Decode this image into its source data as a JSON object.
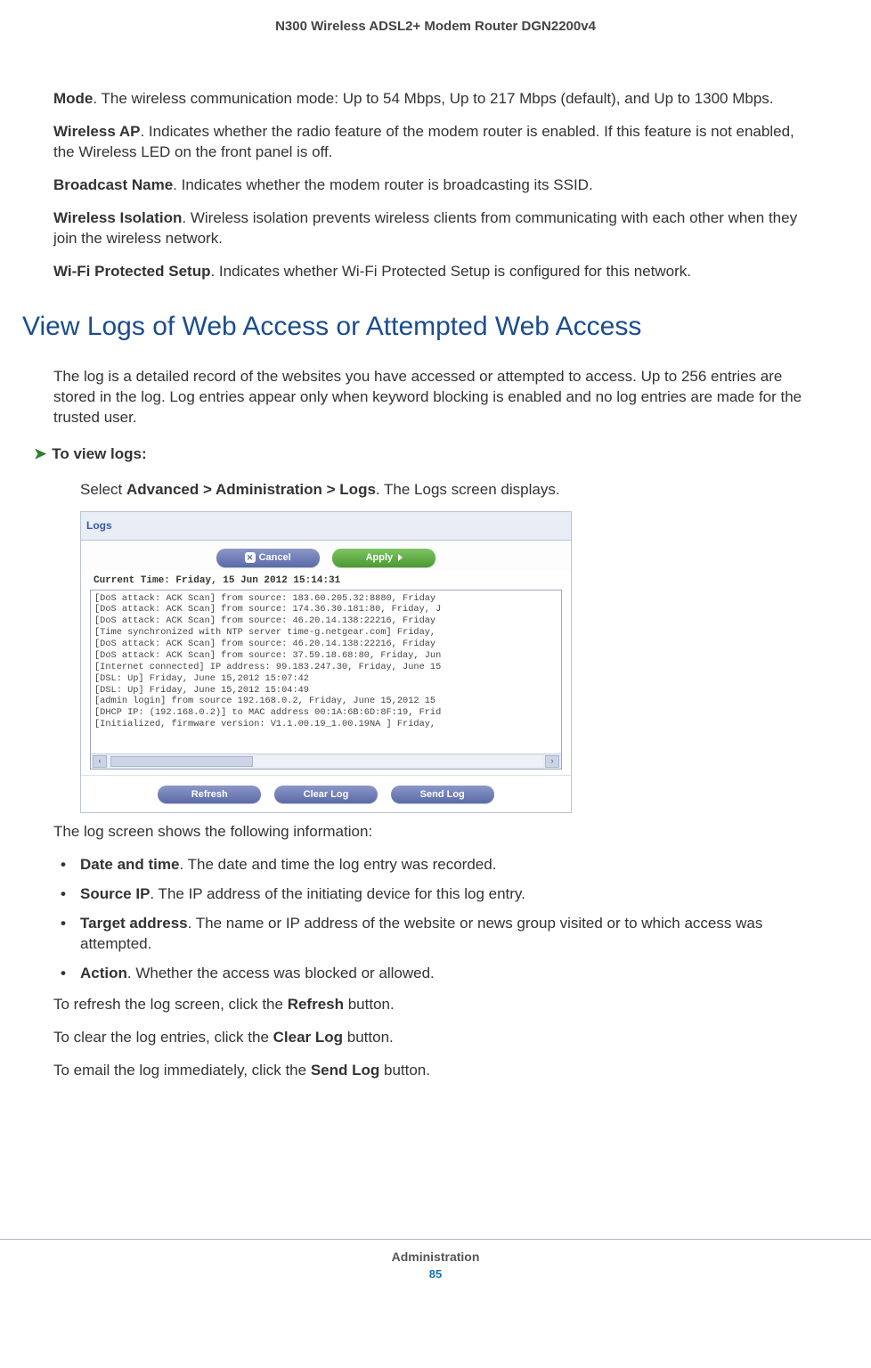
{
  "header": "N300 Wireless ADSL2+ Modem Router DGN2200v4",
  "definitions": [
    {
      "term": "Mode",
      "text": ". The wireless communication mode: Up to 54 Mbps, Up to 217 Mbps (default), and Up to 1300 Mbps."
    },
    {
      "term": "Wireless AP",
      "text": ". Indicates whether the radio feature of the modem router is enabled. If this feature is not enabled, the Wireless LED on the front panel is off."
    },
    {
      "term": "Broadcast Name",
      "text": ". Indicates whether the modem router is broadcasting its SSID."
    },
    {
      "term": "Wireless Isolation",
      "text": ". Wireless isolation prevents wireless clients from communicating with each other when they join the wireless network."
    },
    {
      "term": "Wi-Fi Protected Setup",
      "text": ". Indicates whether Wi-Fi Protected Setup is configured for this network."
    }
  ],
  "section_heading": "View Logs of Web Access or Attempted Web Access",
  "section_intro": "The log is a detailed record of the websites you have accessed or attempted to access. Up to 256 entries are stored in the log. Log entries appear only when keyword blocking is enabled and no log entries are made for the trusted user.",
  "procedure_label": "To view logs:",
  "step_prefix": "Select ",
  "step_breadcrumb": "Advanced > Administration > Logs",
  "step_suffix": ". The Logs screen displays.",
  "screenshot": {
    "title": "Logs",
    "cancel_btn": "Cancel",
    "apply_btn": "Apply",
    "current_time": "Current Time: Friday, 15 Jun 2012 15:14:31",
    "log_lines": [
      "[DoS attack: ACK Scan] from source: 183.60.205.32:8880, Friday",
      "[DoS attack: ACK Scan] from source: 174.36.30.181:80, Friday, J",
      "[DoS attack: ACK Scan] from source: 46.20.14.138:22216, Friday",
      "[Time synchronized with NTP server time-g.netgear.com] Friday,",
      "[DoS attack: ACK Scan] from source: 46.20.14.138:22216, Friday",
      "[DoS attack: ACK Scan] from source: 37.59.18.68:80, Friday, Jun",
      "[Internet connected] IP address: 99.183.247.30, Friday, June 15",
      "[DSL: Up] Friday, June 15,2012 15:07:42",
      "[DSL: Up] Friday, June 15,2012 15:04:49",
      "[admin login] from source 192.168.0.2, Friday, June 15,2012 15",
      "[DHCP IP: (192.168.0.2)] to MAC address 00:1A:6B:6D:8F:19, Frid",
      "[Initialized, firmware version: V1.1.00.19_1.00.19NA ] Friday,"
    ],
    "refresh_btn": "Refresh",
    "clearlog_btn": "Clear Log",
    "sendlog_btn": "Send Log"
  },
  "post_screenshot_text": "The log screen shows the following information:",
  "bullets": [
    {
      "term": "Date and time",
      "text": ". The date and time the log entry was recorded."
    },
    {
      "term": "Source IP",
      "text": ". The IP address of the initiating device for this log entry."
    },
    {
      "term": "Target address",
      "text": ". The name or IP address of the website or news group visited or to which access was attempted."
    },
    {
      "term": "Action",
      "text": ". Whether the access was blocked or allowed."
    }
  ],
  "closing": [
    {
      "pre": "To refresh the log screen, click the ",
      "btn": "Refresh",
      "post": " button."
    },
    {
      "pre": "To clear the log entries, click the ",
      "btn": "Clear Log",
      "post": " button."
    },
    {
      "pre": "To email the log immediately, click the ",
      "btn": "Send Log",
      "post": " button."
    }
  ],
  "footer_section": "Administration",
  "footer_page": "85"
}
